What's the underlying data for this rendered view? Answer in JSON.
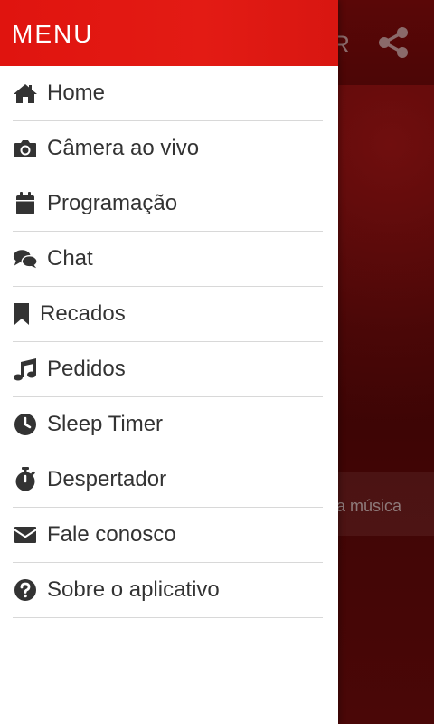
{
  "colors": {
    "accent": "#e31b14",
    "text": "#333333",
    "divider": "#d8d8d8"
  },
  "background_app": {
    "header_text": "R",
    "banner_text": "a música"
  },
  "drawer": {
    "title": "MENU",
    "items": [
      {
        "label": "Home",
        "icon": "home-icon"
      },
      {
        "label": "Câmera ao vivo",
        "icon": "camera-icon"
      },
      {
        "label": "Programação",
        "icon": "calendar-icon"
      },
      {
        "label": "Chat",
        "icon": "chat-icon"
      },
      {
        "label": "Recados",
        "icon": "bookmark-icon"
      },
      {
        "label": "Pedidos",
        "icon": "music-note-icon"
      },
      {
        "label": "Sleep Timer",
        "icon": "clock-icon"
      },
      {
        "label": "Despertador",
        "icon": "stopwatch-icon"
      },
      {
        "label": "Fale conosco",
        "icon": "envelope-icon"
      },
      {
        "label": "Sobre o aplicativo",
        "icon": "question-circle-icon"
      }
    ]
  }
}
